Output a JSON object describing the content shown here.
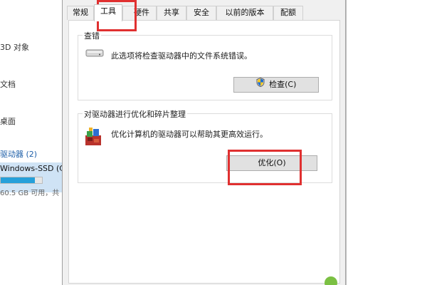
{
  "explorer": {
    "items": [
      {
        "label": "3D 对象"
      },
      {
        "label": "文档"
      },
      {
        "label": "桌面"
      }
    ],
    "section": "驱动器 (2)",
    "drive": {
      "name": "Windows-SSD (C:)",
      "free_text": "60.5 GB 可用，共",
      "used_fraction": 0.82
    }
  },
  "dialog": {
    "tabs": [
      {
        "label": "常规"
      },
      {
        "label": "工具"
      },
      {
        "label": "硬件"
      },
      {
        "label": "共享"
      },
      {
        "label": "安全"
      },
      {
        "label": "以前的版本"
      },
      {
        "label": "配额"
      }
    ],
    "active_tab": "工具",
    "check": {
      "title": "查错",
      "description": "此选项将检查驱动器中的文件系统错误。",
      "button_label": "检查(C)"
    },
    "optimize": {
      "title": "对驱动器进行优化和碎片整理",
      "description": "优化计算机的驱动器可以帮助其更高效运行。",
      "button_label": "优化(O)"
    }
  },
  "colors": {
    "highlight": "#e03030",
    "accent": "#0078d7",
    "drive_bar": "#26a0da"
  }
}
